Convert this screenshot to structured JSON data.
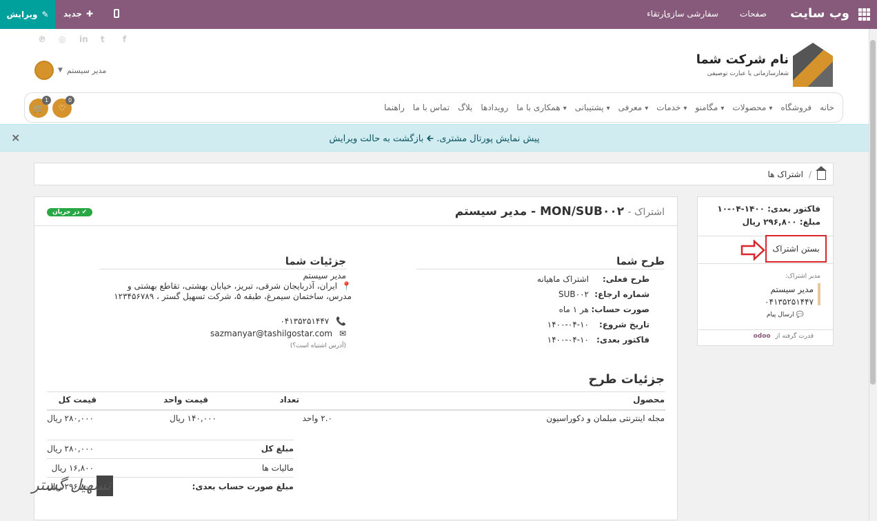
{
  "topbar": {
    "brand": "وب سایت",
    "menu": [
      "صفحات",
      "سفارشی سازی",
      "ارتقاء"
    ],
    "new_label": "جدید",
    "edit_label": "ویرایش"
  },
  "header": {
    "company_name": "نام شرکت شما",
    "company_tagline": "شعارسازمانی یا عبارت توصیفی",
    "user_name": "مدیر سیستم"
  },
  "nav": {
    "items": [
      {
        "label": "خانه",
        "caret": false
      },
      {
        "label": "فروشگاه",
        "caret": false
      },
      {
        "label": "محصولات",
        "caret": true
      },
      {
        "label": "مگامنو",
        "caret": true
      },
      {
        "label": "خدمات",
        "caret": true
      },
      {
        "label": "معرفی",
        "caret": true
      },
      {
        "label": "پشتیبانی",
        "caret": true
      },
      {
        "label": "همکاری با ما",
        "caret": true
      },
      {
        "label": "رویدادها",
        "caret": false
      },
      {
        "label": "بلاگ",
        "caret": false
      },
      {
        "label": "تماس با ما",
        "caret": false
      },
      {
        "label": "راهنما",
        "caret": false
      }
    ],
    "cart_count": "1",
    "wishlist_count": "0"
  },
  "alert": {
    "text": "پیش نمایش پورتال مشتری.",
    "link": "بازگشت به حالت ویرایش"
  },
  "breadcrumb": {
    "current": "اشتراک ها"
  },
  "subscription": {
    "title_prefix": "اشتراک -",
    "title": "MON/SUB۰۰۲ - مدیر سیستم",
    "status": "در جریان"
  },
  "plan": {
    "heading": "طرح شما",
    "rows": [
      {
        "label": "طرح فعلی:",
        "value": "اشتراک ماهیانه"
      },
      {
        "label": "شماره ارجاع:",
        "value": "SUB۰۰۲"
      },
      {
        "label": "صورت حساب:",
        "value": "هر ۱ ماه"
      },
      {
        "label": "تاریخ شروع:",
        "value": "۱۴۰۰-۰۴-۱۰"
      },
      {
        "label": "فاکتور بعدی:",
        "value": "۱۴۰۰-۰۴-۱۰"
      }
    ]
  },
  "details": {
    "heading": "جزئیات شما",
    "name": "مدیر سیستم",
    "address": "ایران، آذربایجان شرقی، تبریز، خیابان بهشتی، تقاطع بهشتی و مدرس، ساختمان سیمرغ، طبقه ۵، شرکت تسهیل گستر ، ۱۲۳۴۵۶۷۸۹",
    "phone": "۰۴۱۳۵۲۵۱۴۴۷",
    "email": "sazmanyar@tashilgostar.com",
    "wrong_address": "(آدرس اشتباه است؟)"
  },
  "plan_details": {
    "heading": "جزئیات طرح",
    "columns": [
      "محصول",
      "تعداد",
      "قیمت واحد",
      "قیمت کل"
    ],
    "rows": [
      {
        "product": "مجله اینترنتی مبلمان و دکوراسیون",
        "qty": "۲.۰ واحد",
        "unit": "۱۴۰,۰۰۰ ریال",
        "total": "۲۸۰,۰۰۰ ریال"
      }
    ],
    "totals": [
      {
        "label": "مبلغ کل",
        "value": "۲۸۰,۰۰۰ ریال"
      },
      {
        "label": "مالیات ها",
        "value": "۱۶,۸۰۰ ریال"
      },
      {
        "label": "مبلغ صورت حساب بعدی:",
        "value": "۲۹۶,۸۰۰ ریال"
      }
    ]
  },
  "side": {
    "next_invoice": "فاکتور بعدی: ۱۴۰۰-۰۴-۱۰",
    "amount": "مبلغ: ۲۹۶,۸۰۰ ریال",
    "close_label": "بستن اشتراک",
    "manager_label": "مدیر اشتراک:",
    "manager_name": "مدیر سیستم",
    "manager_phone": "۰۴۱۳۵۲۵۱۴۴۷",
    "send_message": "ارسال پیام",
    "powered_by": "قدرت گرفته از",
    "odoo": "odoo"
  },
  "watermark": {
    "text": "تسهیل گستر"
  },
  "colors": {
    "topbar": "#875a7b",
    "edit": "#00a09d",
    "accent": "#d6932b",
    "alert_bg": "#d1ecf1",
    "badge": "#28a745",
    "highlight": "#d9262c"
  }
}
